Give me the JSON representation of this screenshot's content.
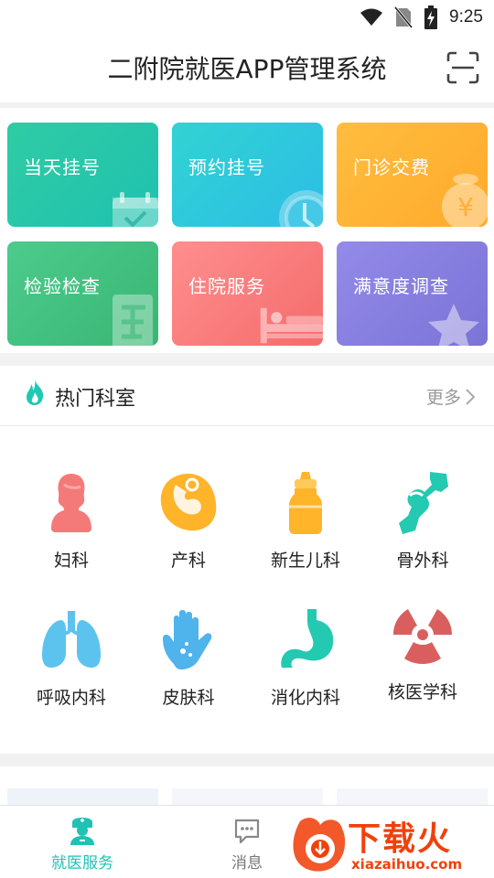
{
  "status_bar": {
    "time": "9:25"
  },
  "header": {
    "title": "二附院就医APP管理系统"
  },
  "quick_actions": [
    {
      "label": "当天挂号",
      "color_from": "#2cc9a5",
      "color_to": "#1fc0b0",
      "icon": "calendar-check-icon"
    },
    {
      "label": "预约挂号",
      "color_from": "#2ed2d6",
      "color_to": "#2fbfe8",
      "icon": "clock-icon"
    },
    {
      "label": "门诊交费",
      "color_from": "#ffb93a",
      "color_to": "#ffab2c",
      "icon": "yen-moneybag-icon"
    },
    {
      "label": "检验检查",
      "color_from": "#48c98a",
      "color_to": "#3bb874",
      "icon": "lab-report-icon"
    },
    {
      "label": "住院服务",
      "color_from": "#ff8a8a",
      "color_to": "#f66d6d",
      "icon": "hospital-bed-icon"
    },
    {
      "label": "满意度调查",
      "color_from": "#8f87e8",
      "color_to": "#7c74d8",
      "icon": "star-icon"
    }
  ],
  "hot_departments": {
    "title": "热门科室",
    "more_label": "更多",
    "items": [
      {
        "name": "妇科",
        "icon": "woman-silhouette-icon"
      },
      {
        "name": "产科",
        "icon": "fetus-icon"
      },
      {
        "name": "新生儿科",
        "icon": "baby-bottle-icon"
      },
      {
        "name": "骨外科",
        "icon": "bone-joint-icon"
      },
      {
        "name": "呼吸内科",
        "icon": "lungs-icon"
      },
      {
        "name": "皮肤科",
        "icon": "hand-skin-icon"
      },
      {
        "name": "消化内科",
        "icon": "stomach-icon"
      },
      {
        "name": "核医学科",
        "icon": "radiation-icon"
      }
    ]
  },
  "bottom_nav": [
    {
      "label": "就医服务",
      "active": true,
      "icon": "doctor-nurse-icon"
    },
    {
      "label": "消息",
      "active": false,
      "icon": "message-bubble-icon"
    }
  ],
  "watermark": {
    "text_cn": "下载火",
    "text_en": "xiazaihuo.com"
  },
  "colors": {
    "accent": "#1fc2b4",
    "inactive": "#777777"
  }
}
